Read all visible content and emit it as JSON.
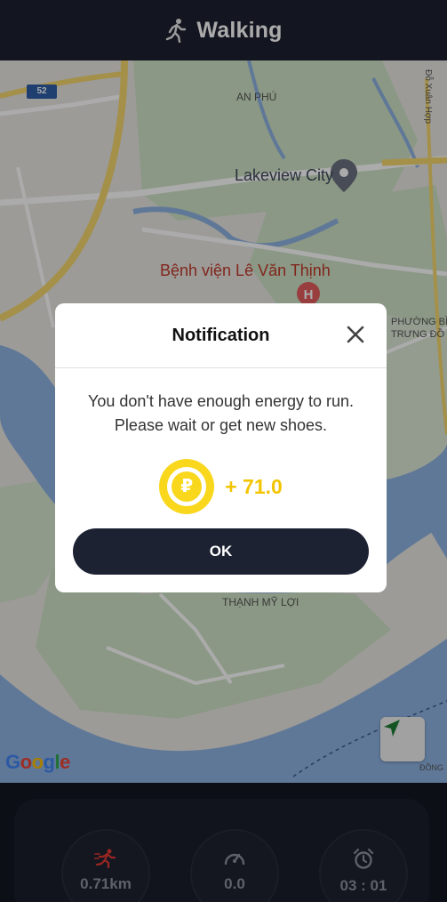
{
  "header": {
    "title": "Walking",
    "icon": "walking-person-icon"
  },
  "map": {
    "labels": {
      "an_phu": "AN PHÚ",
      "xuan_hop": "Đỗ Xuân Hợp",
      "lakeview": "Lakeview City",
      "hospital": "Bệnh viện Lê Văn Thịnh",
      "phuong_line1": "PHƯỜNG BÌ",
      "phuong_line2": "TRƯNG ĐỒ",
      "thanh_my_loi": "THẠNH MỸ LỢI",
      "dong": "ĐỒNG"
    },
    "road_shield": "52",
    "attribution": [
      "G",
      "o",
      "o",
      "g",
      "l",
      "e"
    ],
    "colors": {
      "land": "#e9e7e2",
      "water": "#8fb4e3",
      "park": "#cfe3c6",
      "highway": "#f5d76e"
    }
  },
  "modal": {
    "title": "Notification",
    "message_line1": "You don't have enough energy to run.",
    "message_line2": "Please wait or get new shoes.",
    "coin_symbol": "₽",
    "reward": "+ 71.0",
    "ok_label": "OK"
  },
  "stats": {
    "distance": "0.71km",
    "speed": "0.0",
    "time": "03 : 01"
  },
  "colors": {
    "accent_yellow": "#f9d71c",
    "dark_navy": "#1d2233",
    "runner_red": "#e53935"
  }
}
